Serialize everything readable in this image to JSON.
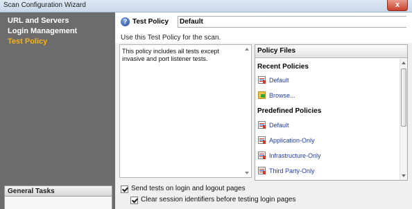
{
  "window": {
    "title": "Scan Configuration Wizard",
    "close_glyph": "x"
  },
  "sidebar": {
    "items": [
      {
        "label": "URL and Servers",
        "active": false
      },
      {
        "label": "Login Management",
        "active": false
      },
      {
        "label": "Test Policy",
        "active": true
      }
    ],
    "general_tasks": {
      "title": "General Tasks"
    }
  },
  "main": {
    "help_glyph": "?",
    "policy_label": "Test Policy",
    "policy_value": "Default",
    "use_text": "Use this Test Policy for the scan.",
    "description": "This policy includes all tests except invasive and port listener tests.",
    "policy_files": {
      "title": "Policy Files",
      "recent": {
        "label": "Recent Policies",
        "items": [
          {
            "label": "Default",
            "icon": "policy-doc-icon"
          },
          {
            "label": "Browse...",
            "icon": "folder-open-icon"
          }
        ]
      },
      "predefined": {
        "label": "Predefined Policies",
        "items": [
          {
            "label": "Default",
            "icon": "policy-doc-icon"
          },
          {
            "label": "Application-Only",
            "icon": "policy-doc-icon"
          },
          {
            "label": "Infrastructure-Only",
            "icon": "policy-doc-icon"
          },
          {
            "label": "Third Party-Only",
            "icon": "policy-doc-icon"
          }
        ]
      }
    },
    "options": [
      {
        "label": "Send tests on login and logout pages",
        "checked": true
      },
      {
        "label": "Clear session identifiers before testing login pages",
        "checked": true
      }
    ]
  }
}
